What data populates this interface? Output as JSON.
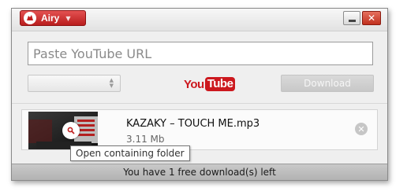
{
  "titlebar": {
    "app_name": "Airy",
    "caret_icon": "chevron-down-icon",
    "minimize_icon": "minimize-icon",
    "close_icon": "close-icon",
    "close_glyph": "✕"
  },
  "input": {
    "placeholder": "Paste YouTube URL",
    "value": ""
  },
  "format_select": {
    "selected": ""
  },
  "youtube_logo": {
    "you": "You",
    "tube": "Tube"
  },
  "download_button": {
    "label": "Download"
  },
  "downloads": [
    {
      "title": "KAZAKY – TOUCH ME.mp3",
      "size": "3.11 Mb",
      "thumbnail_icon": "video-thumbnail",
      "action_icon": "search-icon",
      "remove_glyph": "✕"
    }
  ],
  "tooltip": {
    "text": "Open containing folder"
  },
  "status": {
    "text": "You have 1 free download(s) left"
  },
  "colors": {
    "brand_red": "#cc181e",
    "titlebar_button_red": "#c1301e",
    "disabled_button": "#cfcfcf"
  }
}
